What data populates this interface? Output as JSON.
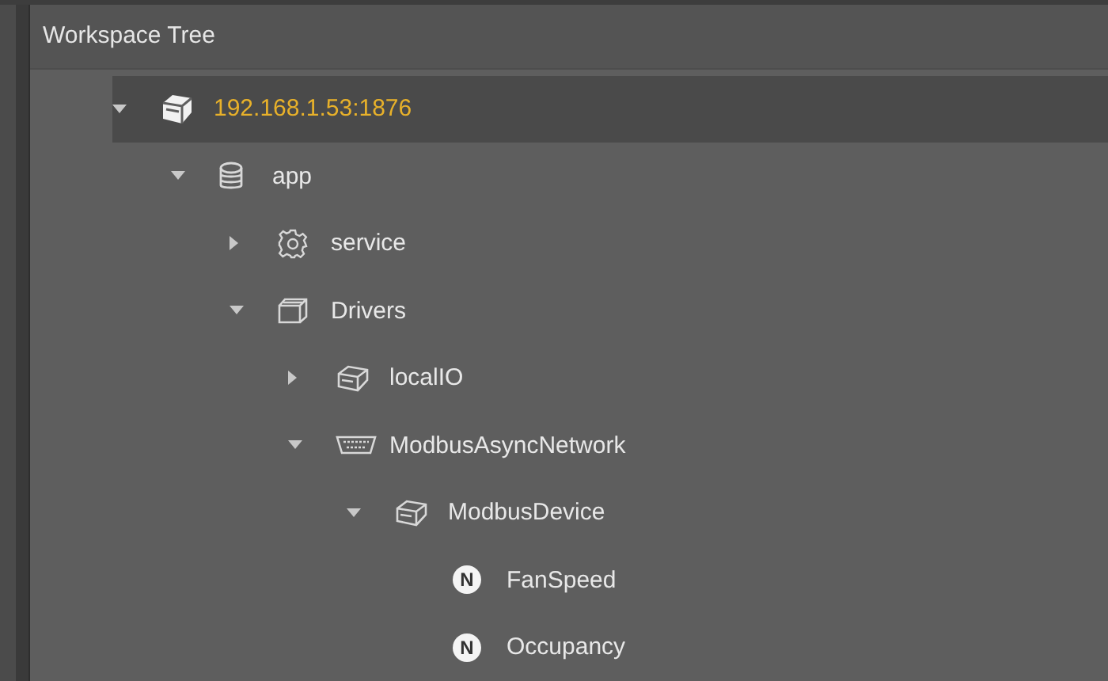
{
  "panel": {
    "title": "Workspace Tree"
  },
  "tree": [
    {
      "label": "192.168.1.53:1876",
      "kind": "station",
      "expanded": true,
      "selected": true,
      "children": [
        {
          "label": "app",
          "kind": "database",
          "expanded": true,
          "selected": false,
          "children": [
            {
              "label": "service",
              "kind": "gear",
              "expanded": false,
              "selected": false
            },
            {
              "label": "Drivers",
              "kind": "folder",
              "expanded": true,
              "selected": false,
              "children": [
                {
                  "label": "localIO",
                  "kind": "device",
                  "expanded": false,
                  "selected": false
                },
                {
                  "label": "ModbusAsyncNetwork",
                  "kind": "port",
                  "expanded": true,
                  "selected": false,
                  "children": [
                    {
                      "label": "ModbusDevice",
                      "kind": "device",
                      "expanded": true,
                      "selected": false,
                      "children": [
                        {
                          "label": "FanSpeed",
                          "kind": "point",
                          "badge": "N",
                          "selected": false
                        },
                        {
                          "label": "Occupancy",
                          "kind": "point",
                          "badge": "N",
                          "selected": false
                        }
                      ]
                    }
                  ]
                }
              ]
            }
          ]
        }
      ]
    }
  ]
}
